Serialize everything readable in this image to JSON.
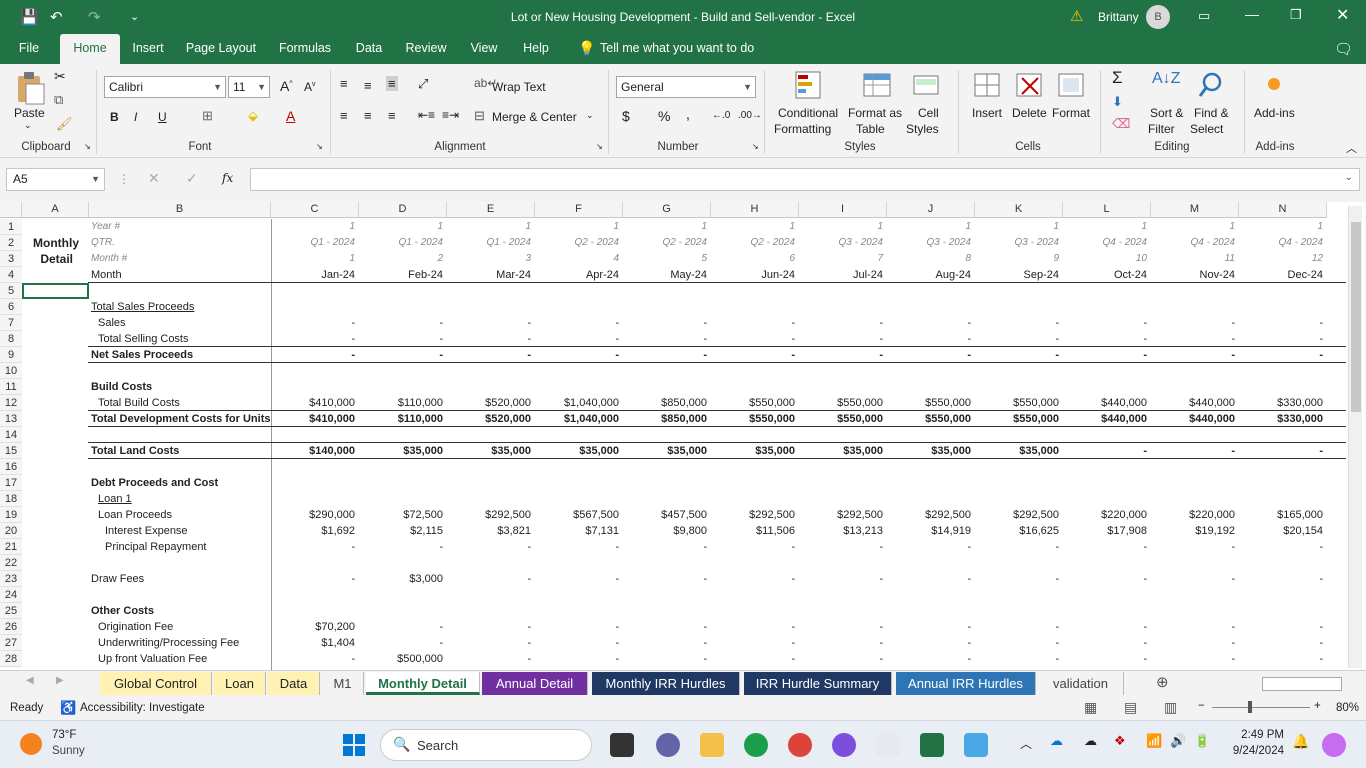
{
  "title": {
    "qa_icons": [
      "save-icon",
      "undo-icon",
      "redo-icon",
      "customize-icon"
    ],
    "text": "Lot or New Housing Development - Build and Sell-vendor  -  Excel",
    "warn": "⚠",
    "user": "Brittany",
    "avatar": "B"
  },
  "menu": [
    "File",
    "Home",
    "Insert",
    "Page Layout",
    "Formulas",
    "Data",
    "Review",
    "View",
    "Help",
    "Tell me what you want to do"
  ],
  "ribbon": {
    "paste": "Paste",
    "font_name": "Calibri",
    "font_size": "11",
    "wrap_text": "Wrap Text",
    "merge_center": "Merge & Center",
    "number_format": "General",
    "conditional": "Conditional",
    "formatting": "Formatting",
    "format_as": "Format as",
    "table": "Table",
    "cell": "Cell",
    "styles_btn": "Styles",
    "insert": "Insert",
    "delete": "Delete",
    "format": "Format",
    "sort": "Sort &",
    "filter": "Filter",
    "find": "Find &",
    "select": "Select",
    "addins": "Add-ins",
    "groups": [
      "Clipboard",
      "Font",
      "Alignment",
      "Number",
      "Styles",
      "Cells",
      "Editing",
      "Add-ins"
    ]
  },
  "formula_bar": {
    "name_box": "A5",
    "fx": "fx",
    "value": ""
  },
  "columns": [
    "A",
    "B",
    "C",
    "D",
    "E",
    "F",
    "G",
    "H",
    "I",
    "J",
    "K",
    "L",
    "M",
    "N"
  ],
  "rows": [
    "1",
    "2",
    "3",
    "4",
    "5",
    "6",
    "7",
    "8",
    "9",
    "10",
    "11",
    "12",
    "13",
    "14",
    "15",
    "16",
    "17",
    "18",
    "19",
    "20",
    "21",
    "22",
    "23",
    "24",
    "25",
    "26",
    "27",
    "28"
  ],
  "sheet": {
    "monthly": "Monthly",
    "detail": "Detail",
    "labels": {
      "r1": "Year #",
      "r2": "QTR.",
      "r3": "Month #",
      "r4": "Month",
      "r6": "Total Sales Proceeds",
      "r7": "Sales",
      "r8": "Total Selling Costs",
      "r9": "Net Sales Proceeds",
      "r11": "Build Costs",
      "r12": "Total Build Costs",
      "r13": "Total Development Costs for Units",
      "r15": "Total Land Costs",
      "r17": "Debt Proceeds and Cost",
      "r18": "Loan 1",
      "r19": "Loan Proceeds",
      "r20": "Interest Expense",
      "r21": "Principal Repayment",
      "r23": "Draw Fees",
      "r25": "Other Costs",
      "r26": "Origination Fee",
      "r27": "Underwriting/Processing Fee",
      "r28": "Up front Valuation Fee"
    },
    "data": {
      "year": [
        "1",
        "1",
        "1",
        "1",
        "1",
        "1",
        "1",
        "1",
        "1",
        "1",
        "1",
        "1"
      ],
      "qtr": [
        "Q1 - 2024",
        "Q1 - 2024",
        "Q1 - 2024",
        "Q2 - 2024",
        "Q2 - 2024",
        "Q2 - 2024",
        "Q3 - 2024",
        "Q3 - 2024",
        "Q3 - 2024",
        "Q4 - 2024",
        "Q4 - 2024",
        "Q4 - 2024"
      ],
      "month_num": [
        "1",
        "2",
        "3",
        "4",
        "5",
        "6",
        "7",
        "8",
        "9",
        "10",
        "11",
        "12"
      ],
      "month": [
        "Jan-24",
        "Feb-24",
        "Mar-24",
        "Apr-24",
        "May-24",
        "Jun-24",
        "Jul-24",
        "Aug-24",
        "Sep-24",
        "Oct-24",
        "Nov-24",
        "Dec-24"
      ],
      "dash": [
        "-",
        "-",
        "-",
        "-",
        "-",
        "-",
        "-",
        "-",
        "-",
        "-",
        "-",
        "-"
      ],
      "build": [
        "$410,000",
        "$110,000",
        "$520,000",
        "$1,040,000",
        "$850,000",
        "$550,000",
        "$550,000",
        "$550,000",
        "$550,000",
        "$440,000",
        "$440,000",
        "$330,000"
      ],
      "land": [
        "$140,000",
        "$35,000",
        "$35,000",
        "$35,000",
        "$35,000",
        "$35,000",
        "$35,000",
        "$35,000",
        "$35,000",
        "-",
        "-",
        "-"
      ],
      "loan": [
        "$290,000",
        "$72,500",
        "$292,500",
        "$567,500",
        "$457,500",
        "$292,500",
        "$292,500",
        "$292,500",
        "$292,500",
        "$220,000",
        "$220,000",
        "$165,000"
      ],
      "interest": [
        "$1,692",
        "$2,115",
        "$3,821",
        "$7,131",
        "$9,800",
        "$11,506",
        "$13,213",
        "$14,919",
        "$16,625",
        "$17,908",
        "$19,192",
        "$20,154"
      ],
      "draw": [
        "-",
        "$3,000",
        "-",
        "-",
        "-",
        "-",
        "-",
        "-",
        "-",
        "-",
        "-",
        "-"
      ],
      "orig": [
        "$70,200",
        "-",
        "-",
        "-",
        "-",
        "-",
        "-",
        "-",
        "-",
        "-",
        "-",
        "-"
      ],
      "uw": [
        "$1,404",
        "-",
        "-",
        "-",
        "-",
        "-",
        "-",
        "-",
        "-",
        "-",
        "-",
        "-"
      ],
      "val": [
        "-",
        "$500,000",
        "-",
        "-",
        "-",
        "-",
        "-",
        "-",
        "-",
        "-",
        "-",
        "-"
      ]
    }
  },
  "sheet_tabs": [
    {
      "label": "Global Control",
      "bg": "#fff2b2",
      "fg": "#222"
    },
    {
      "label": "Loan",
      "bg": "#fff2b2",
      "fg": "#222"
    },
    {
      "label": "Data",
      "bg": "#fff2b2",
      "fg": "#222"
    },
    {
      "label": "M1",
      "bg": "#f3f3f3",
      "fg": "#444"
    },
    {
      "label": "Monthly Detail",
      "bg": "#ffffff",
      "fg": "#217346",
      "active": true
    },
    {
      "label": "Annual Detail",
      "bg": "#7030a0",
      "fg": "#fff"
    },
    {
      "label": "Monthly IRR Hurdles",
      "bg": "#1f3864",
      "fg": "#fff"
    },
    {
      "label": "IRR Hurdle Summary",
      "bg": "#1f3864",
      "fg": "#fff"
    },
    {
      "label": "Annual IRR Hurdles",
      "bg": "#2e75b6",
      "fg": "#fff"
    },
    {
      "label": "validation",
      "bg": "#f3f3f3",
      "fg": "#444"
    }
  ],
  "status": {
    "ready": "Ready",
    "accessibility": "Accessibility: Investigate",
    "zoom": "80%"
  },
  "taskbar": {
    "temp": "73°F",
    "weather": "Sunny",
    "search": "Search",
    "time": "2:49 PM",
    "date": "9/24/2024"
  },
  "colors": {
    "excel_green": "#217346",
    "selection": "#217346"
  }
}
